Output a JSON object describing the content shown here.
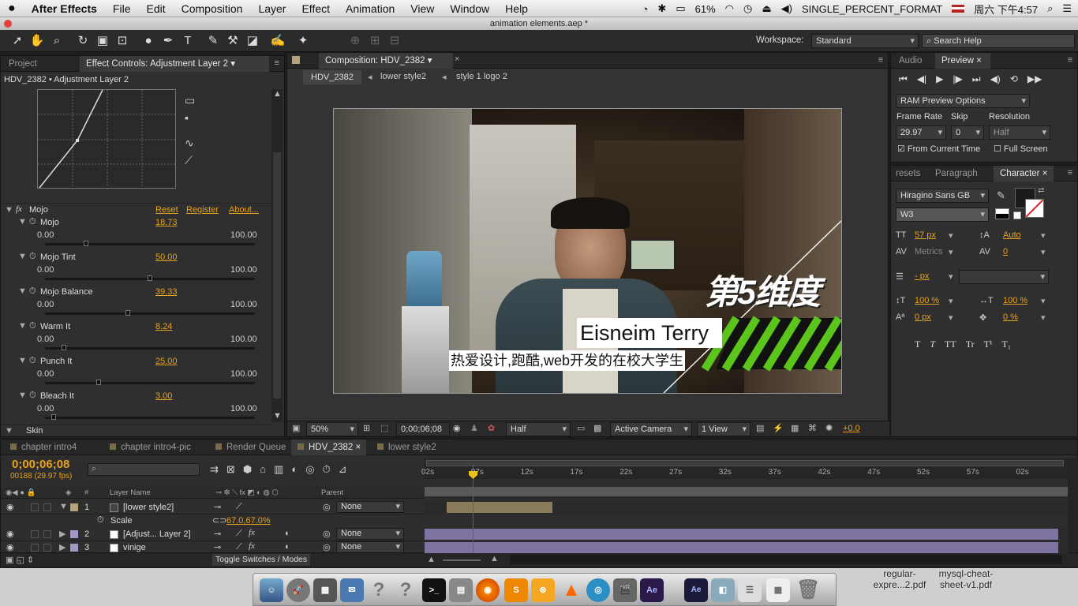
{
  "menubar": {
    "apple": "",
    "app_name": "After Effects",
    "items": [
      "File",
      "Edit",
      "Composition",
      "Layer",
      "Effect",
      "Animation",
      "View",
      "Window",
      "Help"
    ],
    "battery": "61%",
    "format_label": "SINGLE_PERCENT_FORMAT",
    "clock": "周六 下午4:57"
  },
  "window": {
    "title": "animation elements.aep *"
  },
  "toolbar": {
    "workspace_label": "Workspace:",
    "workspace_value": "Standard",
    "search_placeholder": "Search Help"
  },
  "effect_controls": {
    "tab_project": "Project",
    "tab_label": "Effect Controls: Adjustment Layer 2",
    "header": "HDV_2382 • Adjustment Layer 2",
    "fx_name": "Mojo",
    "links": {
      "reset": "Reset",
      "register": "Register",
      "about": "About..."
    },
    "params": [
      {
        "name": "Mojo",
        "value": "18.73",
        "min": "0.00",
        "max": "100.00",
        "pos": 0.1873
      },
      {
        "name": "Mojo Tint",
        "value": "50.00",
        "min": "0.00",
        "max": "100.00",
        "pos": 0.5
      },
      {
        "name": "Mojo Balance",
        "value": "39.33",
        "min": "0.00",
        "max": "100.00",
        "pos": 0.3933
      },
      {
        "name": "Warm It",
        "value": "8.24",
        "min": "0.00",
        "max": "100.00",
        "pos": 0.0824
      },
      {
        "name": "Punch It",
        "value": "25.00",
        "min": "0.00",
        "max": "100.00",
        "pos": 0.25
      },
      {
        "name": "Bleach It",
        "value": "3.00",
        "min": "0.00",
        "max": "100.00",
        "pos": 0.03
      }
    ],
    "skin_label": "Skin"
  },
  "composition": {
    "tab_label": "Composition: HDV_2382",
    "breadcrumbs": [
      "HDV_2382",
      "lower style2",
      "style 1 logo 2"
    ],
    "logo_text": "第5维度",
    "name_text": "Eisneim Terry",
    "subtitle_text": "热爱设计,跑酷,web开发的在校大学生",
    "footer": {
      "zoom": "50%",
      "timecode": "0;00;06;08",
      "resolution": "Half",
      "camera": "Active Camera",
      "views": "1 View",
      "exposure": "+0.0"
    }
  },
  "preview": {
    "tab_audio": "Audio",
    "tab_preview": "Preview",
    "ram_options": "RAM Preview Options",
    "frame_rate_label": "Frame Rate",
    "skip_label": "Skip",
    "resolution_label": "Resolution",
    "frame_rate": "29.97",
    "skip": "0",
    "resolution": "Half",
    "from_current_label": "From Current Time",
    "from_current_checked": true,
    "full_screen_label": "Full Screen",
    "full_screen_checked": false
  },
  "character": {
    "tab_presets": "resets",
    "tab_paragraph": "Paragraph",
    "tab_character": "Character",
    "font": "Hiragino Sans GB",
    "style": "W3",
    "size": "57 px",
    "leading": "Auto",
    "kerning": "Metrics",
    "tracking": "0",
    "stroke": "- px",
    "vscale": "100 %",
    "hscale": "100 %",
    "baseline": "0 px",
    "tsume": "0 %",
    "styles": [
      "T",
      "T",
      "TT",
      "Tr",
      "T¹",
      "T₁"
    ]
  },
  "timeline": {
    "tabs": [
      "chapter intro4",
      "chapter intro4-pic",
      "Render Queue",
      "HDV_2382",
      "lower style2"
    ],
    "active_tab": "HDV_2382",
    "timecode": "0;00;06;08",
    "frames": "00188 (29.97 fps)",
    "col_layer": "Layer Name",
    "col_parent": "Parent",
    "ruler": [
      "02s",
      "07s",
      "12s",
      "17s",
      "22s",
      "27s",
      "32s",
      "37s",
      "42s",
      "47s",
      "52s",
      "57s",
      "02s"
    ],
    "layers": [
      {
        "num": "1",
        "name": "[lower style2]",
        "parent": "None",
        "color": "#b4a27a"
      },
      {
        "num": "2",
        "name": "[Adjust... Layer 2]",
        "parent": "None",
        "color": "#a596c8"
      },
      {
        "num": "3",
        "name": "vinige",
        "parent": "None",
        "color": "#a596c8"
      }
    ],
    "scale_label": "Scale",
    "scale_value": "67.0,67.0%",
    "toggle_label": "Toggle Switches / Modes",
    "playhead_fraction": 0.076
  },
  "desktop": {
    "file1": "regular-\nexpre...2.pdf",
    "file2": "mysql-cheat-\nsheet-v1.pdf"
  }
}
